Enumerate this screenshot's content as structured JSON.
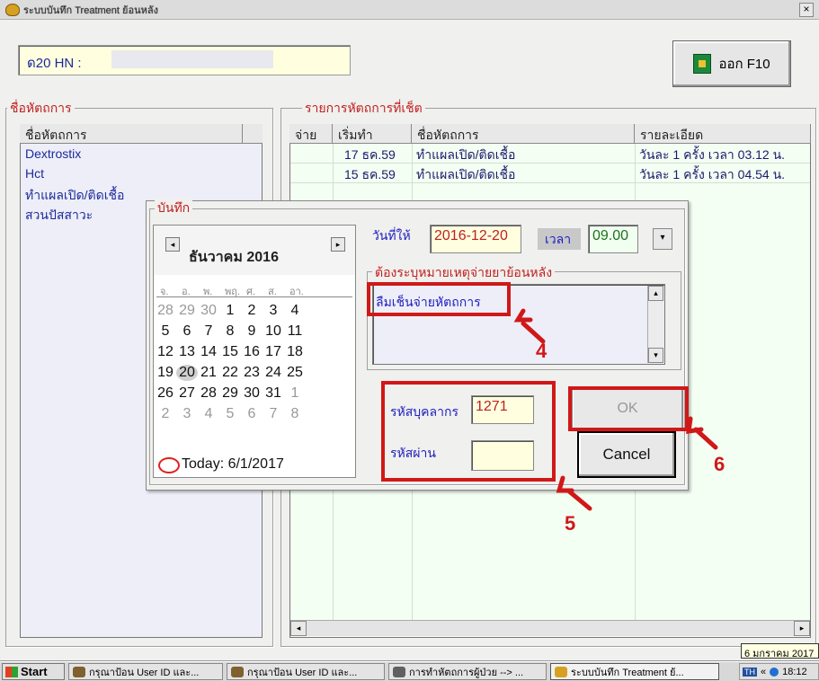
{
  "window": {
    "title": "ระบบบันทึก Treatment ย้อนหลัง",
    "close_glyph": "×"
  },
  "header": {
    "hn_label": "ด20 HN :",
    "hn_value": "",
    "exit_label": "ออก F10"
  },
  "left_panel": {
    "group_label": "ชื่อหัตถการ",
    "column_header": "ชื่อหัตถการ",
    "items": [
      "Dextrostix",
      "Hct",
      "ทำแผลเปิด/ติดเชื้อ",
      "สวนปัสสาวะ"
    ]
  },
  "right_panel": {
    "group_label": "รายการหัตถการที่เช็ต",
    "columns": [
      "จ่าย",
      "เริ่มทำ",
      "ชื่อหัตถการ",
      "รายละเอียด"
    ],
    "rows": [
      {
        "paid": "",
        "start": "17 ธค.59",
        "name": "ทำแผลเปิด/ติดเชื้อ",
        "detail": "วันละ 1 ครั้ง เวลา 03.12 น."
      },
      {
        "paid": "",
        "start": "15 ธค.59",
        "name": "ทำแผลเปิด/ติดเชื้อ",
        "detail": "วันละ 1 ครั้ง เวลา 04.54 น."
      }
    ]
  },
  "dialog": {
    "group_label": "บันทึก",
    "calendar": {
      "month_label": "ธันวาคม 2016",
      "weekdays": [
        "จ.",
        "อ.",
        "พ.",
        "พฤ.",
        "ศ.",
        "ส.",
        "อา."
      ],
      "weeks": [
        [
          "28",
          "29",
          "30",
          "1",
          "2",
          "3",
          "4"
        ],
        [
          "5",
          "6",
          "7",
          "8",
          "9",
          "10",
          "11"
        ],
        [
          "12",
          "13",
          "14",
          "15",
          "16",
          "17",
          "18"
        ],
        [
          "19",
          "20",
          "21",
          "22",
          "23",
          "24",
          "25"
        ],
        [
          "26",
          "27",
          "28",
          "29",
          "30",
          "31",
          "1"
        ],
        [
          "2",
          "3",
          "4",
          "5",
          "6",
          "7",
          "8"
        ]
      ],
      "selected_day": "20",
      "today_label": "Today: 6/1/2017",
      "prev_glyph": "◂",
      "next_glyph": "▸"
    },
    "date_label": "วันที่ให้",
    "date_value": "2016-12-20",
    "time_label": "เวลา",
    "time_value": "09.00",
    "reason_group_label": "ต้องระบุหมายเหตุจ่ายยาย้อนหลัง",
    "reason_value": "ลืมเช็นจ่ายหัตถการ",
    "staff_id_label": "รหัสบุคลากร",
    "staff_id_value": "1271",
    "password_label": "รหัสผ่าน",
    "password_value": "",
    "ok_label": "OK",
    "cancel_label": "Cancel"
  },
  "annotations": [
    "4",
    "5",
    "6"
  ],
  "taskbar": {
    "start_label": "Start",
    "tasks": [
      "กรุณาป้อน User ID และ...",
      "กรุณาป้อน User ID และ...",
      "การทำหัตถการผู้ป่วย --> ...",
      "ระบบบันทึก Treatment ย้..."
    ],
    "tray_lang": "TH",
    "tray_arrows": "«",
    "clock": "18:12",
    "tooltip": "6 มกราคม 2017"
  },
  "colors": {
    "annotation": "#d01818",
    "label_blue": "#2020c0",
    "group_label_red": "#c02020",
    "field_bg": "#ffffe0"
  }
}
